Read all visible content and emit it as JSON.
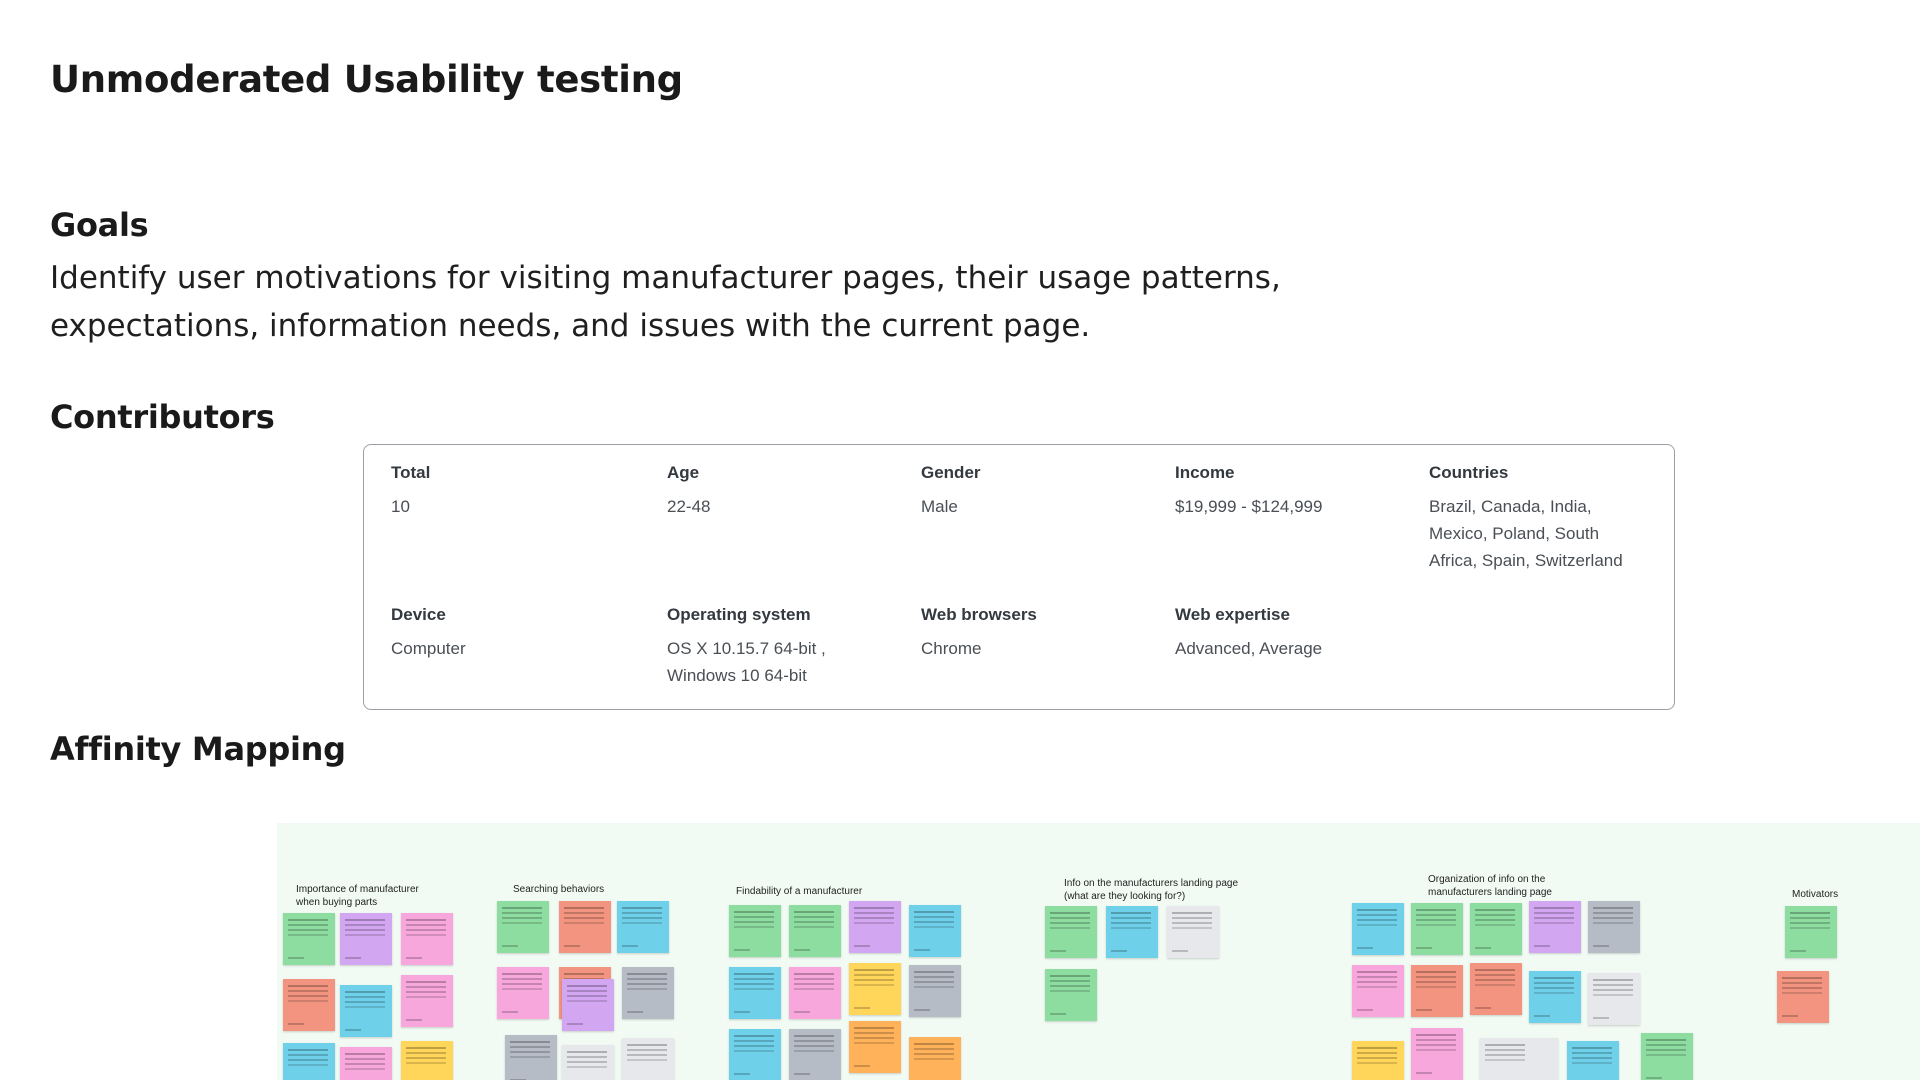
{
  "page": {
    "title": "Unmoderated Usability testing"
  },
  "goals": {
    "heading": "Goals",
    "text": "Identify user motivations for visiting manufacturer pages, their usage patterns, expectations, information needs, and issues with the current page."
  },
  "contributors": {
    "heading": "Contributors",
    "fields": [
      {
        "label": "Total",
        "value": "10"
      },
      {
        "label": "Age",
        "value": "22-48"
      },
      {
        "label": "Gender",
        "value": "Male"
      },
      {
        "label": "Income",
        "value": "$19,999 - $124,999"
      },
      {
        "label": "Countries",
        "value": "Brazil, Canada, India, Mexico, Poland, South Africa, Spain, Switzerland"
      },
      {
        "label": "Device",
        "value": "Computer"
      },
      {
        "label": "Operating system",
        "value": "OS X 10.15.7 64-bit , Windows 10 64-bit"
      },
      {
        "label": "Web browsers",
        "value": "Chrome"
      },
      {
        "label": "Web expertise",
        "value": "Advanced, Average"
      }
    ]
  },
  "affinity": {
    "heading": "Affinity Mapping",
    "clusters": [
      {
        "title": "Importance of manufacturer when buying parts"
      },
      {
        "title": "Searching behaviors"
      },
      {
        "title": "Findability of a manufacturer"
      },
      {
        "title": "Info on the manufacturers landing page (what are they looking for?)"
      },
      {
        "title": "Organization of info on the manufacturers landing page"
      },
      {
        "title": "Motivators"
      }
    ]
  }
}
